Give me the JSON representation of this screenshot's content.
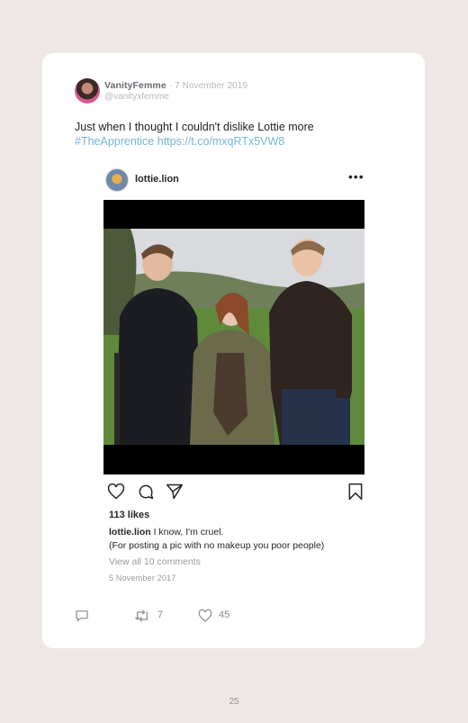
{
  "tweet": {
    "display_name": "VanityFemme",
    "date": "7 November 2019",
    "handle": "@vanityxfemme",
    "text": "Just when I thought I couldn't dislike Lottie more",
    "hashtag": "#TheApprentice",
    "link": "https://t.co/mxqRTx5VW8",
    "retweets": "7",
    "likes": "45"
  },
  "instagram": {
    "username": "lottie.lion",
    "more_label": "•••",
    "likes": "113 likes",
    "caption_user": "lottie.lion",
    "caption_text": "I know, I'm cruel.",
    "caption_line2": "(For posting a pic with no makeup you poor people)",
    "view_comments": "View all 10 comments",
    "date": "5 November 2017"
  },
  "icons": {
    "reply": "reply-icon",
    "retweet": "retweet-icon",
    "like": "heart-icon",
    "ig_like": "heart-icon",
    "ig_comment": "comment-icon",
    "ig_share": "paper-plane-icon",
    "ig_save": "bookmark-icon"
  },
  "colors": {
    "background": "#efe6e6",
    "card": "#ffffff",
    "link": "#72b6d8"
  },
  "page_number": "25"
}
